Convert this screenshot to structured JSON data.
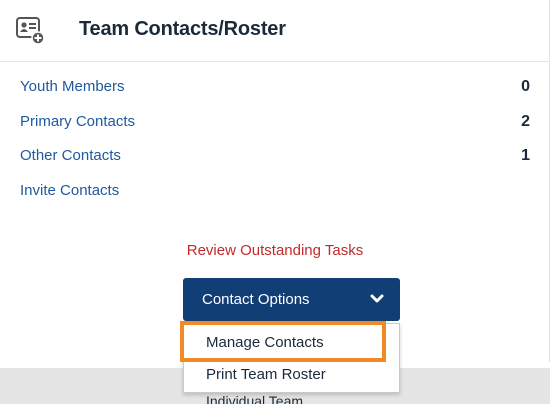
{
  "header": {
    "title": "Team Contacts/Roster",
    "icon": "contact-card-add-icon"
  },
  "rows": [
    {
      "label": "Youth Members",
      "count": "0"
    },
    {
      "label": "Primary Contacts",
      "count": "2"
    },
    {
      "label": "Other Contacts",
      "count": "1"
    },
    {
      "label": "Invite Contacts",
      "count": ""
    }
  ],
  "review_link": "Review Outstanding Tasks",
  "contact_options": {
    "label": "Contact Options",
    "icon": "chevron-down-icon",
    "menu_items": [
      "Manage Contacts",
      "Print Team Roster"
    ]
  },
  "bottom": {
    "label": "Individual Team"
  },
  "colors": {
    "link": "#1e5aa0",
    "alert": "#c32a2a",
    "button": "#123e76",
    "highlight": "#f08a24",
    "strip": "#e5e5e5"
  }
}
